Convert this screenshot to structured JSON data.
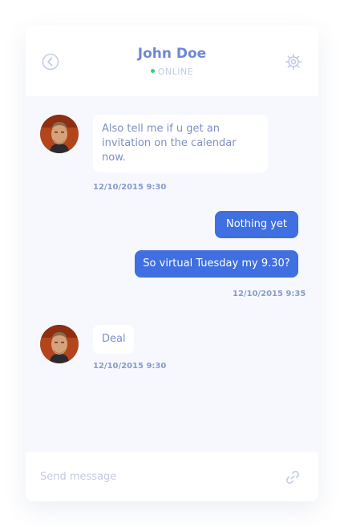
{
  "header": {
    "contact_name": "John Doe",
    "status": "ONLINE",
    "back_icon": "chevron-left-circle-icon",
    "settings_icon": "gear-icon"
  },
  "messages": [
    {
      "direction": "incoming",
      "text": "Also tell me if u get an invitation on the calendar now."
    },
    {
      "direction": "outgoing",
      "text": "Nothing yet"
    },
    {
      "direction": "outgoing",
      "text": "So virtual Tuesday my 9.30?"
    },
    {
      "direction": "incoming",
      "text": "Deal"
    }
  ],
  "timestamps": [
    "12/10/2015 9:30",
    "12/10/2015 9:35",
    "12/10/2015 9:30"
  ],
  "composer": {
    "placeholder": "Send message",
    "attach_icon": "link-icon"
  },
  "colors": {
    "accent": "#3f6fe0",
    "title": "#6f87d6",
    "online": "#2ed47a",
    "chat_background": "#f6f8fe"
  }
}
